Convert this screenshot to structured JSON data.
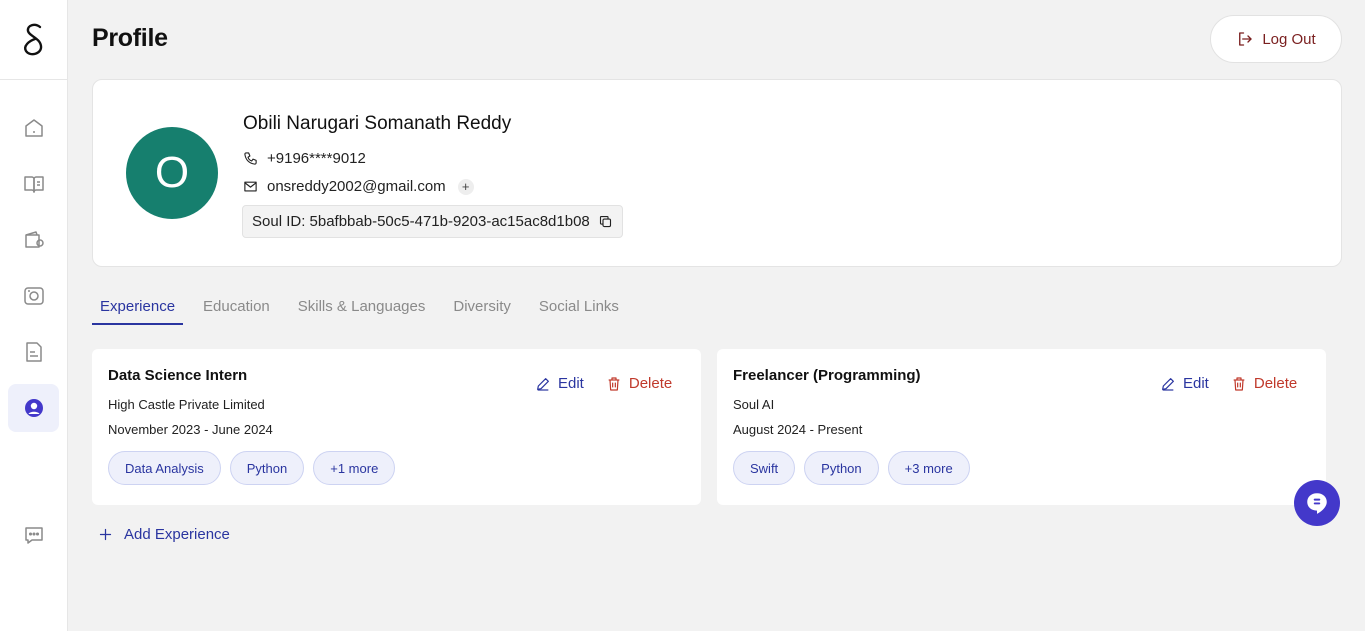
{
  "header": {
    "title": "Profile",
    "logout_label": "Log Out"
  },
  "sidebar": {
    "items": [
      {
        "name": "home-icon"
      },
      {
        "name": "book-icon"
      },
      {
        "name": "wallet-icon"
      },
      {
        "name": "camera-icon"
      },
      {
        "name": "document-icon"
      },
      {
        "name": "profile-icon",
        "active": true
      },
      {
        "name": "chat-icon"
      }
    ]
  },
  "profile": {
    "avatar_initial": "O",
    "name": "Obili Narugari Somanath Reddy",
    "phone": "+9196****9012",
    "email": "onsreddy2002@gmail.com",
    "soul_id": "Soul ID: 5bafbbab-50c5-471b-9203-ac15ac8d1b08"
  },
  "tabs": [
    {
      "label": "Experience",
      "active": true
    },
    {
      "label": "Education"
    },
    {
      "label": "Skills & Languages"
    },
    {
      "label": "Diversity"
    },
    {
      "label": "Social Links"
    }
  ],
  "experience": [
    {
      "title": "Data Science Intern",
      "company": "High Castle Private Limited",
      "dates": "November 2023 - June 2024",
      "chips": [
        "Data Analysis",
        "Python",
        "+1 more"
      ],
      "edit_label": "Edit",
      "delete_label": "Delete"
    },
    {
      "title": "Freelancer (Programming)",
      "company": "Soul AI",
      "dates": "August 2024 - Present",
      "chips": [
        "Swift",
        "Python",
        "+3 more"
      ],
      "edit_label": "Edit",
      "delete_label": "Delete"
    }
  ],
  "add_experience_label": "Add Experience",
  "colors": {
    "accent": "#2a35a0",
    "avatar": "#167f6e",
    "delete": "#c0392b",
    "logout": "#7a1f1f",
    "chat_fab": "#4338ca"
  }
}
